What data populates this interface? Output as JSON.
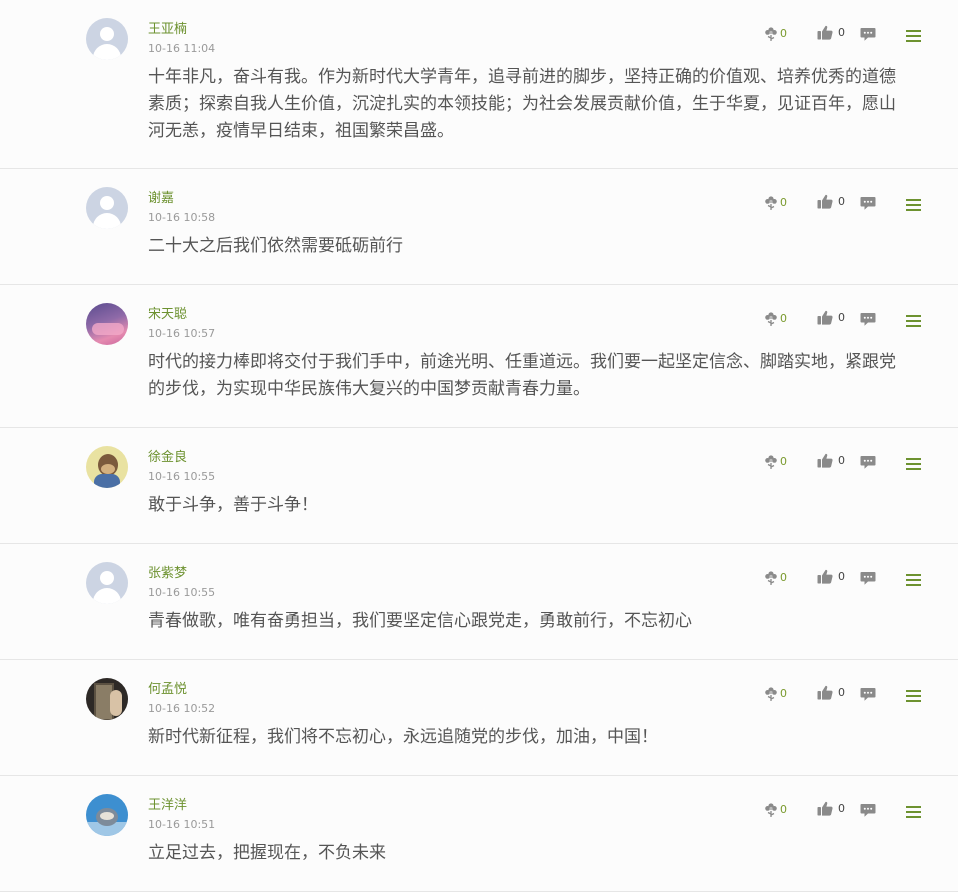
{
  "comments": [
    {
      "name": "王亚楠",
      "time": "10-16 11:04",
      "avatar": "default",
      "text": "十年非凡，奋斗有我。作为新时代大学青年，追寻前进的脚步，坚持正确的价值观、培养优秀的道德素质；探索自我人生价值，沉淀扎实的本领技能；为社会发展贡献价值，生于华夏，见证百年，愿山河无恙，疫情早日结束，祖国繁荣昌盛。",
      "flowers": "0",
      "likes": "0"
    },
    {
      "name": "谢嘉",
      "time": "10-16 10:58",
      "avatar": "default",
      "text": "二十大之后我们依然需要砥砺前行",
      "flowers": "0",
      "likes": "0"
    },
    {
      "name": "宋天聪",
      "time": "10-16 10:57",
      "avatar": "sky",
      "text": "时代的接力棒即将交付于我们手中，前途光明、任重道远。我们要一起坚定信念、脚踏实地，紧跟党的步伐，为实现中华民族伟大复兴的中国梦贡献青春力量。",
      "flowers": "0",
      "likes": "0"
    },
    {
      "name": "徐金良",
      "time": "10-16 10:55",
      "avatar": "monkey",
      "text": "敢于斗争，善于斗争！",
      "flowers": "0",
      "likes": "0"
    },
    {
      "name": "张紫梦",
      "time": "10-16 10:55",
      "avatar": "default",
      "text": "青春做歌，唯有奋勇担当，我们要坚定信心跟党走，勇敢前行，不忘初心",
      "flowers": "0",
      "likes": "0"
    },
    {
      "name": "何孟悦",
      "time": "10-16 10:52",
      "avatar": "dark",
      "text": "新时代新征程，我们将不忘初心，永远追随党的步伐，加油，中国！",
      "flowers": "0",
      "likes": "0"
    },
    {
      "name": "王洋洋",
      "time": "10-16 10:51",
      "avatar": "cat",
      "text": "立足过去，把握现在，不负未来",
      "flowers": "0",
      "likes": "0"
    }
  ],
  "colors": {
    "accent": "#6d9230",
    "text": "#555555",
    "muted": "#9a9a9a",
    "divider": "#e6e6e6"
  },
  "icons": {
    "flower": "flower-icon",
    "like": "thumbs-up-icon",
    "reply": "comment-icon",
    "menu": "menu-icon"
  }
}
